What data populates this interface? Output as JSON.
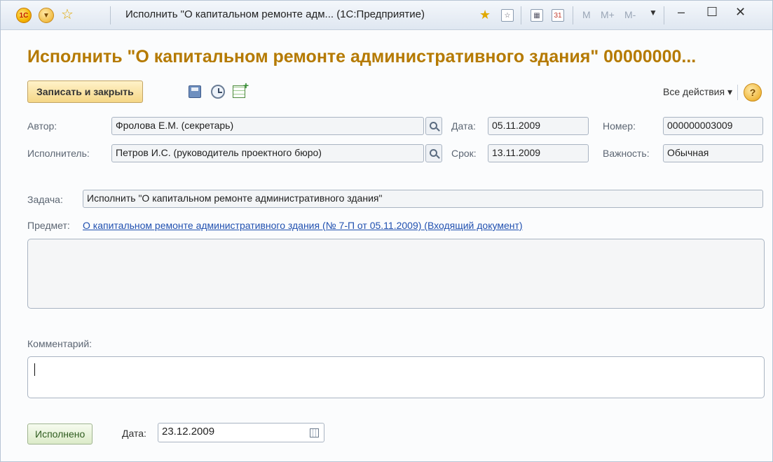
{
  "window": {
    "title": "Исполнить \"О капитальном ремонте адм... (1С:Предприятие)",
    "logo_text": "1С",
    "controls": [
      "M",
      "M+",
      "M-"
    ]
  },
  "header": {
    "title": "Исполнить \"О капитальном ремонте административного здания\" 00000000..."
  },
  "toolbar": {
    "save_close_label": "Записать и закрыть",
    "all_actions_label": "Все действия ▾",
    "help_label": "?"
  },
  "form": {
    "author_label": "Автор:",
    "author_value": "Фролова Е.М. (секретарь)",
    "date_label": "Дата:",
    "date_value": "05.11.2009",
    "number_label": "Номер:",
    "number_value": "000000003009",
    "executor_label": "Исполнитель:",
    "executor_value": "Петров И.С. (руководитель проектного бюро)",
    "due_label": "Срок:",
    "due_value": "13.11.2009",
    "importance_label": "Важность:",
    "importance_value": "Обычная",
    "task_label": "Задача:",
    "task_value": "Исполнить \"О капитальном ремонте административного здания\"",
    "subject_label": "Предмет:",
    "subject_link": "О капитальном ремонте административного здания (№ 7-П от 05.11.2009) (Входящий документ)",
    "comment_label": "Комментарий:",
    "comment_value": ""
  },
  "footer": {
    "done_label": "Исполнено",
    "date_label": "Дата:",
    "date_value": "23.12.2009"
  },
  "colors": {
    "title": "#b57a00",
    "link": "#2050b0",
    "primary_button": "#f5d787",
    "done_button": "#dcebc9"
  }
}
